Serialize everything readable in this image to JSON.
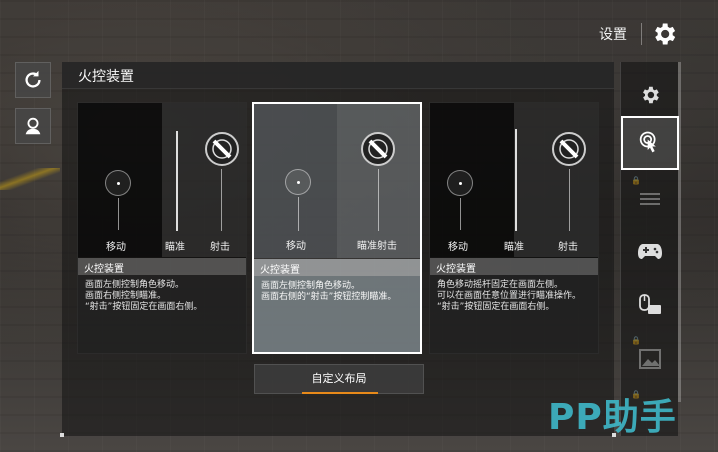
{
  "header": {
    "settings_label": "设置"
  },
  "panel": {
    "title": "火控装置"
  },
  "options": [
    {
      "controls": [
        "移动",
        "瞄准",
        "射击"
      ],
      "desc_title": "火控装置",
      "desc_text": "画面左侧控制角色移动。\n画面右侧控制瞄准。\n“射击”按钮固定在画面右侧。"
    },
    {
      "controls": [
        "移动",
        "瞄准射击"
      ],
      "desc_title": "火控装置",
      "desc_text": "画面左侧控制角色移动。\n画面右侧的“射击”按钮控制瞄准。"
    },
    {
      "controls": [
        "移动",
        "瞄准",
        "射击"
      ],
      "desc_title": "火控装置",
      "desc_text": "角色移动摇杆固定在画面左侧。\n可以在画面任意位置进行瞄准操作。\n“射击”按钮固定在画面右侧。"
    }
  ],
  "custom_layout_label": "自定义布局",
  "sidebar": {
    "items": [
      {
        "icon": "gear-icon",
        "active": false,
        "locked": false
      },
      {
        "icon": "touch-icon",
        "active": true,
        "locked": false
      },
      {
        "icon": "sliders-icon",
        "active": false,
        "locked": true
      },
      {
        "icon": "gamepad-icon",
        "active": false,
        "locked": false
      },
      {
        "icon": "mouse-keyboard-icon",
        "active": false,
        "locked": false
      },
      {
        "icon": "image-icon",
        "active": false,
        "locked": true
      },
      {
        "icon": "more-icon",
        "active": false,
        "locked": true
      }
    ]
  },
  "watermark": "PP助手",
  "colors": {
    "accent": "#e88a1a",
    "watermark": "#3fb8c8",
    "selected_border": "#ffffff"
  }
}
